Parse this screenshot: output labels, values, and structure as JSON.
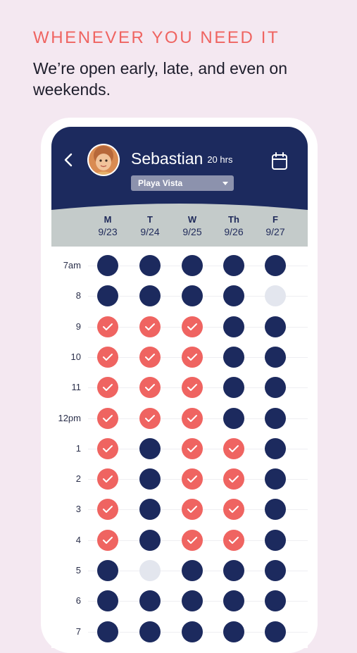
{
  "headline": "WHENEVER YOU NEED IT",
  "subline": "We’re open early, late, and even on weekends.",
  "profile": {
    "name": "Sebastian",
    "hours": "20 hrs",
    "location": "Playa Vista"
  },
  "days": [
    {
      "letter": "M",
      "date": "9/23"
    },
    {
      "letter": "T",
      "date": "9/24"
    },
    {
      "letter": "W",
      "date": "9/25"
    },
    {
      "letter": "Th",
      "date": "9/26"
    },
    {
      "letter": "F",
      "date": "9/27"
    }
  ],
  "rows": [
    {
      "label": "7am",
      "states": [
        "booked",
        "booked",
        "booked",
        "booked",
        "booked"
      ]
    },
    {
      "label": "8",
      "states": [
        "booked",
        "booked",
        "booked",
        "booked",
        "empty"
      ]
    },
    {
      "label": "9",
      "states": [
        "checked",
        "checked",
        "checked",
        "booked",
        "booked"
      ]
    },
    {
      "label": "10",
      "states": [
        "checked",
        "checked",
        "checked",
        "booked",
        "booked"
      ]
    },
    {
      "label": "11",
      "states": [
        "checked",
        "checked",
        "checked",
        "booked",
        "booked"
      ]
    },
    {
      "label": "12pm",
      "states": [
        "checked",
        "checked",
        "checked",
        "booked",
        "booked"
      ]
    },
    {
      "label": "1",
      "states": [
        "checked",
        "booked",
        "checked",
        "checked",
        "booked"
      ]
    },
    {
      "label": "2",
      "states": [
        "checked",
        "booked",
        "checked",
        "checked",
        "booked"
      ]
    },
    {
      "label": "3",
      "states": [
        "checked",
        "booked",
        "checked",
        "checked",
        "booked"
      ]
    },
    {
      "label": "4",
      "states": [
        "checked",
        "booked",
        "checked",
        "checked",
        "booked"
      ]
    },
    {
      "label": "5",
      "states": [
        "booked",
        "empty",
        "booked",
        "booked",
        "booked"
      ]
    },
    {
      "label": "6",
      "states": [
        "booked",
        "booked",
        "booked",
        "booked",
        "booked"
      ]
    },
    {
      "label": "7",
      "states": [
        "booked",
        "booked",
        "booked",
        "booked",
        "booked"
      ]
    }
  ],
  "colors": {
    "accent": "#ef6461",
    "navy": "#1c2a5e",
    "day_band": "#c4cbca",
    "available": "#e3e6ee",
    "background": "#f4e8f1"
  },
  "icons": {
    "back": "chevron-left-icon",
    "calendar": "calendar-icon",
    "dropdown": "caret-down-icon",
    "check": "checkmark-icon"
  }
}
